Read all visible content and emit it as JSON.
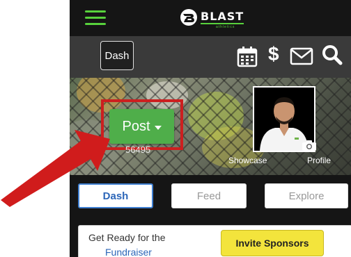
{
  "header": {
    "logo_text": "BLAST",
    "logo_subtext": "athletics",
    "menu_icon": "hamburger-icon",
    "accent_color": "#58d23c"
  },
  "subbar": {
    "dash_label": "Dash",
    "icons": [
      "calendar-icon",
      "dollar-icon",
      "mail-icon",
      "search-icon"
    ],
    "dollar_glyph": "$"
  },
  "banner": {
    "post_label": "Post",
    "post_count": "56495",
    "showcase_label": "Showcase",
    "profile_label": "Profile",
    "post_color": "#4fae4a",
    "highlight_color": "#cc1f1f"
  },
  "tabs": [
    {
      "label": "Dash",
      "active": true
    },
    {
      "label": "Feed",
      "active": false
    },
    {
      "label": "Explore",
      "active": false
    }
  ],
  "card": {
    "line1": "Get Ready for the",
    "line2": "Fundraiser",
    "invite_label": "Invite Sponsors",
    "invite_color": "#f3e43c"
  },
  "annotation": {
    "arrow_color": "#d01c1c"
  }
}
